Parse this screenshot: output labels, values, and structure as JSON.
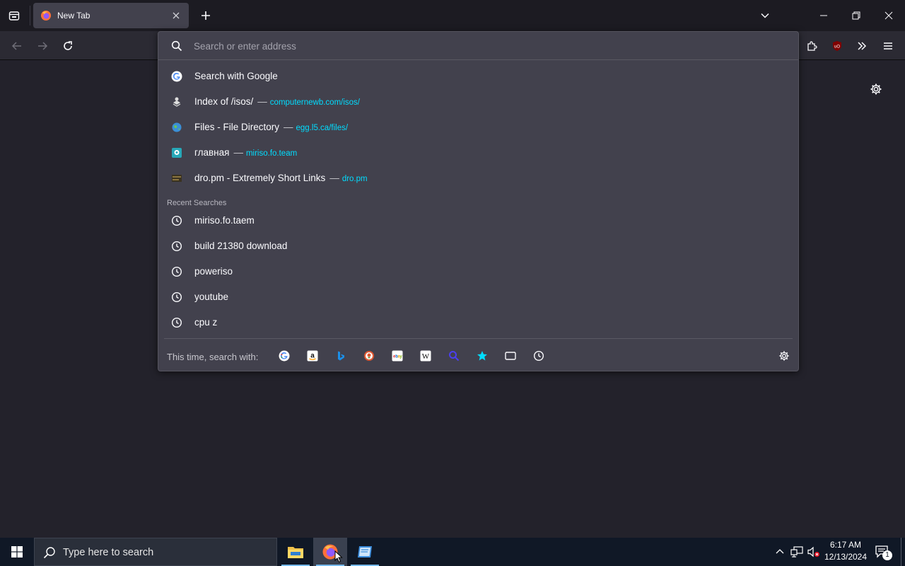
{
  "browser": {
    "tab": {
      "title": "New Tab"
    }
  },
  "urlbar": {
    "placeholder": "Search or enter address",
    "top_result": "Search with Google",
    "results": [
      {
        "title": "Index of /isos/",
        "dash": "—",
        "url": "computernewb.com/isos/",
        "icon": "globe-dark-icon"
      },
      {
        "title": "Files - File Directory",
        "dash": "—",
        "url": "egg.l5.ca/files/",
        "icon": "earth-icon"
      },
      {
        "title": "главная",
        "dash": "—",
        "url": "miriso.fo.team",
        "icon": "site-icon"
      },
      {
        "title": "dro.pm - Extremely Short Links",
        "dash": "—",
        "url": "dro.pm",
        "icon": "dropm-icon"
      }
    ],
    "recent_label": "Recent Searches",
    "recent": [
      "miriso.fo.taem",
      "build 21380 download",
      "poweriso",
      "youtube",
      "cpu z"
    ],
    "footer_label": "This time, search with:",
    "engines": [
      "google-icon",
      "amazon-icon",
      "bing-icon",
      "duckduckgo-icon",
      "ebay-icon",
      "wikipedia-icon",
      "search-icon",
      "bookmarks-icon",
      "tabs-icon",
      "history-icon"
    ]
  },
  "taskbar": {
    "search_placeholder": "Type here to search",
    "time": "6:17 AM",
    "date": "12/13/2024",
    "notification_count": "1"
  }
}
